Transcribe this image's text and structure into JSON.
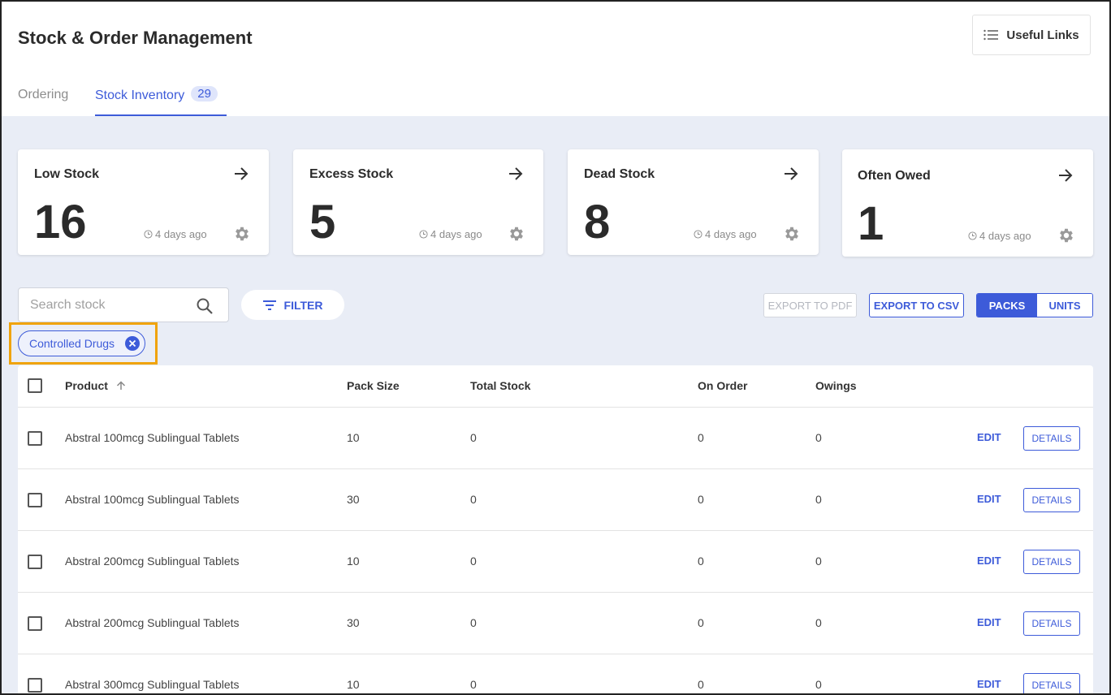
{
  "header": {
    "title": "Stock & Order Management",
    "useful_links_label": "Useful Links",
    "tabs": [
      {
        "label": "Ordering"
      },
      {
        "label": "Stock Inventory",
        "badge": "29"
      }
    ]
  },
  "cards": [
    {
      "title": "Low Stock",
      "value": "16",
      "time": "4 days ago"
    },
    {
      "title": "Excess Stock",
      "value": "5",
      "time": "4 days ago"
    },
    {
      "title": "Dead Stock",
      "value": "8",
      "time": "4 days ago"
    },
    {
      "title": "Often Owed",
      "value": "1",
      "time": "4 days ago"
    }
  ],
  "toolbar": {
    "search_placeholder": "Search stock",
    "filter_label": "FILTER",
    "export_pdf_label": "EXPORT TO PDF",
    "export_csv_label": "EXPORT TO CSV",
    "packs_label": "PACKS",
    "units_label": "UNITS"
  },
  "active_filter": {
    "label": "Controlled Drugs"
  },
  "table": {
    "columns": [
      "Product",
      "Pack Size",
      "Total Stock",
      "On Order",
      "Owings"
    ],
    "edit_label": "EDIT",
    "details_label": "DETAILS",
    "rows": [
      {
        "product": "Abstral 100mcg Sublingual Tablets",
        "pack_size": "10",
        "total_stock": "0",
        "on_order": "0",
        "owings": "0"
      },
      {
        "product": "Abstral 100mcg Sublingual Tablets",
        "pack_size": "30",
        "total_stock": "0",
        "on_order": "0",
        "owings": "0"
      },
      {
        "product": "Abstral 200mcg Sublingual Tablets",
        "pack_size": "10",
        "total_stock": "0",
        "on_order": "0",
        "owings": "0"
      },
      {
        "product": "Abstral 200mcg Sublingual Tablets",
        "pack_size": "30",
        "total_stock": "0",
        "on_order": "0",
        "owings": "0"
      },
      {
        "product": "Abstral 300mcg Sublingual Tablets",
        "pack_size": "10",
        "total_stock": "0",
        "on_order": "0",
        "owings": "0"
      }
    ]
  },
  "colors": {
    "accent": "#3d5bd9",
    "highlight": "#f0a30a",
    "background": "#e9edf6"
  }
}
